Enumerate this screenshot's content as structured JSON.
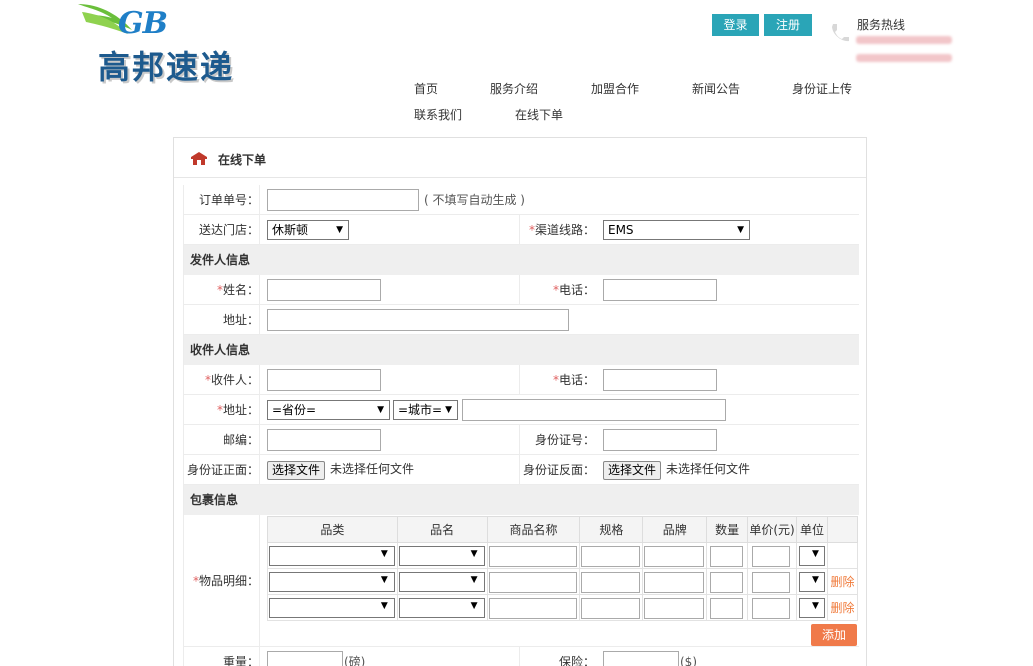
{
  "header": {
    "logo_latin": "GB",
    "logo_cn": "高邦速递",
    "login": "登录",
    "register": "注册",
    "hotline_label": "服务热线"
  },
  "nav": [
    "首页",
    "服务介绍",
    "加盟合作",
    "新闻公告",
    "身份证上传",
    "联系我们",
    "在线下单"
  ],
  "panel": {
    "title": "在线下单"
  },
  "form": {
    "order_no_label": "订单单号：",
    "order_no_hint": "( 不填写自动生成 )",
    "store_label": "送达门店：",
    "store_value": "休斯顿",
    "channel_label": "渠道线路：",
    "channel_value": "EMS",
    "sender_section": "发件人信息",
    "sender_name_label": "姓名：",
    "sender_phone_label": "电话：",
    "sender_addr_label": "地址：",
    "receiver_section": "收件人信息",
    "receiver_name_label": "收件人：",
    "receiver_phone_label": "电话：",
    "receiver_addr_label": "地址：",
    "province_value": "=省份=",
    "city_value": "=城市=",
    "zip_label": "邮编：",
    "id_no_label": "身份证号：",
    "id_front_label": "身份证正面：",
    "id_back_label": "身份证反面：",
    "file_btn": "选择文件",
    "file_none": "未选择任何文件",
    "package_section": "包裹信息",
    "items_label": "物品明细：",
    "columns": [
      "品类",
      "品名",
      "商品名称",
      "规格",
      "品牌",
      "数量",
      "单价(元)",
      "单位"
    ],
    "delete_label": "删除",
    "add_label": "添加",
    "weight_label": "重量：",
    "weight_unit": "(磅)",
    "insure_label": "保险：",
    "insure_unit": "($)",
    "required_mark": "*"
  }
}
